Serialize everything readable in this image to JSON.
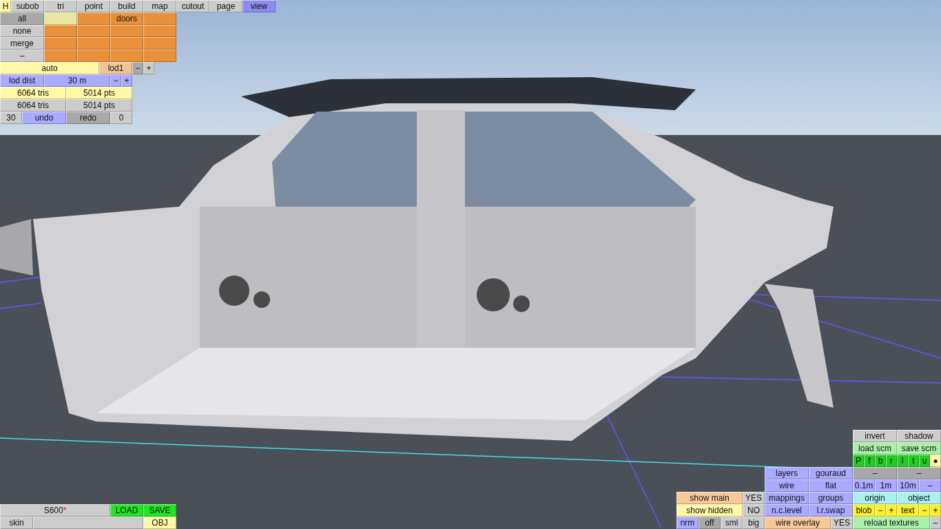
{
  "help_button": {
    "label": "H",
    "color": "#fff8a0"
  },
  "tabs": [
    {
      "label": "subob",
      "selected": false
    },
    {
      "label": "tri",
      "selected": false
    },
    {
      "label": "point",
      "selected": false
    },
    {
      "label": "build",
      "selected": false
    },
    {
      "label": "map",
      "selected": false
    },
    {
      "label": "cutout",
      "selected": false
    },
    {
      "label": "page",
      "selected": false
    },
    {
      "label": "view",
      "selected": true
    }
  ],
  "panels": [
    {
      "rows": [
        {
          "buttons": [
            {
              "label": "all",
              "color": "#a8a8a8"
            },
            {
              "color": "#e8e6a0"
            },
            {
              "color": "#e8903a"
            },
            {
              "label": "doors",
              "color": "#e8903a"
            },
            {
              "color": "#e8903a"
            }
          ]
        },
        {
          "buttons": [
            {
              "label": "none",
              "color": "#cccccc"
            },
            {
              "color": "#e8903a"
            },
            {
              "color": "#e8903a"
            },
            {
              "color": "#e8903a"
            },
            {
              "color": "#e8903a"
            }
          ]
        },
        {
          "buttons": [
            {
              "label": "merge",
              "color": "#cccccc"
            },
            {
              "color": "#e8903a"
            },
            {
              "color": "#e8903a"
            },
            {
              "color": "#e8903a"
            },
            {
              "color": "#e8903a"
            }
          ]
        },
        {
          "buttons": [
            {
              "label": "–",
              "color": "#cccccc"
            },
            {
              "color": "#e8903a"
            },
            {
              "color": "#e8903a"
            },
            {
              "color": "#e8903a"
            },
            {
              "color": "#e8903a"
            }
          ]
        },
        {
          "buttons": [
            {
              "label": "auto",
              "color": "#fff8a8"
            },
            {
              "label": "lod1",
              "color": "#f0c49a"
            },
            {
              "label": "−",
              "color": "#a8a8a8"
            },
            {
              "label": "+",
              "color": "#cccccc"
            }
          ]
        },
        {
          "buttons": [
            {
              "label": "lod dist",
              "color": "#aaaaff"
            },
            {
              "label": "30 m",
              "color": "#aaaaff"
            },
            {
              "label": "−",
              "color": "#aaaaff"
            },
            {
              "label": "+",
              "color": "#aaaaff"
            }
          ]
        },
        {
          "buttons": [
            {
              "label": "6064 tris",
              "color": "#fff8a8"
            },
            {
              "label": "5014 pts",
              "color": "#fff8a8"
            }
          ]
        },
        {
          "buttons": [
            {
              "label": "6064 tris",
              "color": "#cccccc"
            },
            {
              "label": "5014 pts",
              "color": "#cccccc"
            }
          ]
        },
        {
          "buttons": [
            {
              "label": "30",
              "color": "#cccccc"
            },
            {
              "label": "undo",
              "color": "#aaaaff"
            },
            {
              "label": "redo",
              "color": "#a8a8a8"
            },
            {
              "label": "0",
              "color": "#cccccc"
            }
          ]
        }
      ]
    },
    {
      "rows": [
        {
          "buttons": [
            {
              "label": "S600",
              "suffix": "*",
              "color": "#cccccc"
            },
            {
              "label": "LOAD",
              "color": "#22e622"
            },
            {
              "label": "SAVE",
              "color": "#22e622"
            }
          ]
        },
        {
          "buttons": [
            {
              "label": "skin",
              "color": "#cccccc"
            },
            {
              "color": "#cccccc"
            },
            {
              "label": "OBJ",
              "color": "#fff8a8"
            }
          ]
        }
      ]
    },
    {
      "rows": [
        {
          "buttons": [
            {
              "label": "invert",
              "color": "#cccccc"
            },
            {
              "label": "shadow",
              "color": "#cccccc"
            }
          ]
        },
        {
          "buttons": [
            {
              "label": "load scm",
              "color": "#aaf0aa"
            },
            {
              "label": "save scm",
              "color": "#aaf0aa"
            }
          ]
        },
        {
          "buttons": [
            {
              "label": "P",
              "color": "#22cc22"
            },
            {
              "label": "f",
              "color": "#22cc22"
            },
            {
              "label": "b",
              "color": "#22cc22"
            },
            {
              "label": "r",
              "color": "#22cc22"
            },
            {
              "label": "l",
              "color": "#22cc22"
            },
            {
              "label": "t",
              "color": "#22cc22"
            },
            {
              "label": "u",
              "color": "#22cc22"
            },
            {
              "label": "●",
              "color": "#fff8a8"
            }
          ]
        },
        {
          "buttons": [
            {
              "label": "layers",
              "color": "#aaaaff"
            },
            {
              "label": "gouraud",
              "color": "#aaaaff"
            },
            {
              "label": "–",
              "color": "#a8a8a8"
            },
            {
              "label": "–",
              "color": "#a8a8a8"
            }
          ]
        },
        {
          "buttons": [
            {
              "label": "wire",
              "color": "#aaaaff"
            },
            {
              "label": "flat",
              "color": "#aaaaff"
            },
            {
              "label": "0.1m",
              "color": "#aaaaff"
            },
            {
              "label": "1m",
              "color": "#aaaaff"
            },
            {
              "label": "10m",
              "color": "#aaaaff"
            },
            {
              "label": "–",
              "color": "#aaaaff"
            }
          ]
        },
        {
          "buttons": [
            {
              "label": "show main",
              "color": "#f8c89a"
            },
            {
              "label": "YES",
              "color": "#cccccc"
            },
            {
              "label": "mappings",
              "color": "#aaaaff"
            },
            {
              "label": "groups",
              "color": "#aaaaff"
            },
            {
              "label": "origin",
              "color": "#aaf0f0"
            },
            {
              "label": "object",
              "color": "#aaf0f0"
            }
          ]
        },
        {
          "buttons": [
            {
              "label": "show hidden",
              "color": "#fff8a8"
            },
            {
              "label": "NO",
              "color": "#cccccc"
            },
            {
              "label": "n.c.level",
              "color": "#aaaaff"
            },
            {
              "label": "l.r.swap",
              "color": "#aaaaff"
            },
            {
              "label": "blob",
              "color": "#f8f030"
            },
            {
              "label": "−",
              "color": "#f8f030"
            },
            {
              "label": "+",
              "color": "#f8f030"
            },
            {
              "label": "text",
              "color": "#f8f030"
            },
            {
              "label": "−",
              "color": "#f8f030"
            },
            {
              "label": "+",
              "color": "#f8f030"
            }
          ]
        },
        {
          "buttons": [
            {
              "label": "nrm",
              "color": "#aaaaff"
            },
            {
              "label": "off",
              "color": "#a8a8a8"
            },
            {
              "label": "sml",
              "color": "#cccccc"
            },
            {
              "label": "big",
              "color": "#cccccc"
            },
            {
              "label": "wire overlay",
              "color": "#f8c89a"
            },
            {
              "label": "YES",
              "color": "#cccccc"
            },
            {
              "label": "reload textures",
              "color": "#aaf0aa"
            },
            {
              "label": "–",
              "color": "#cccccc"
            }
          ]
        }
      ]
    }
  ]
}
